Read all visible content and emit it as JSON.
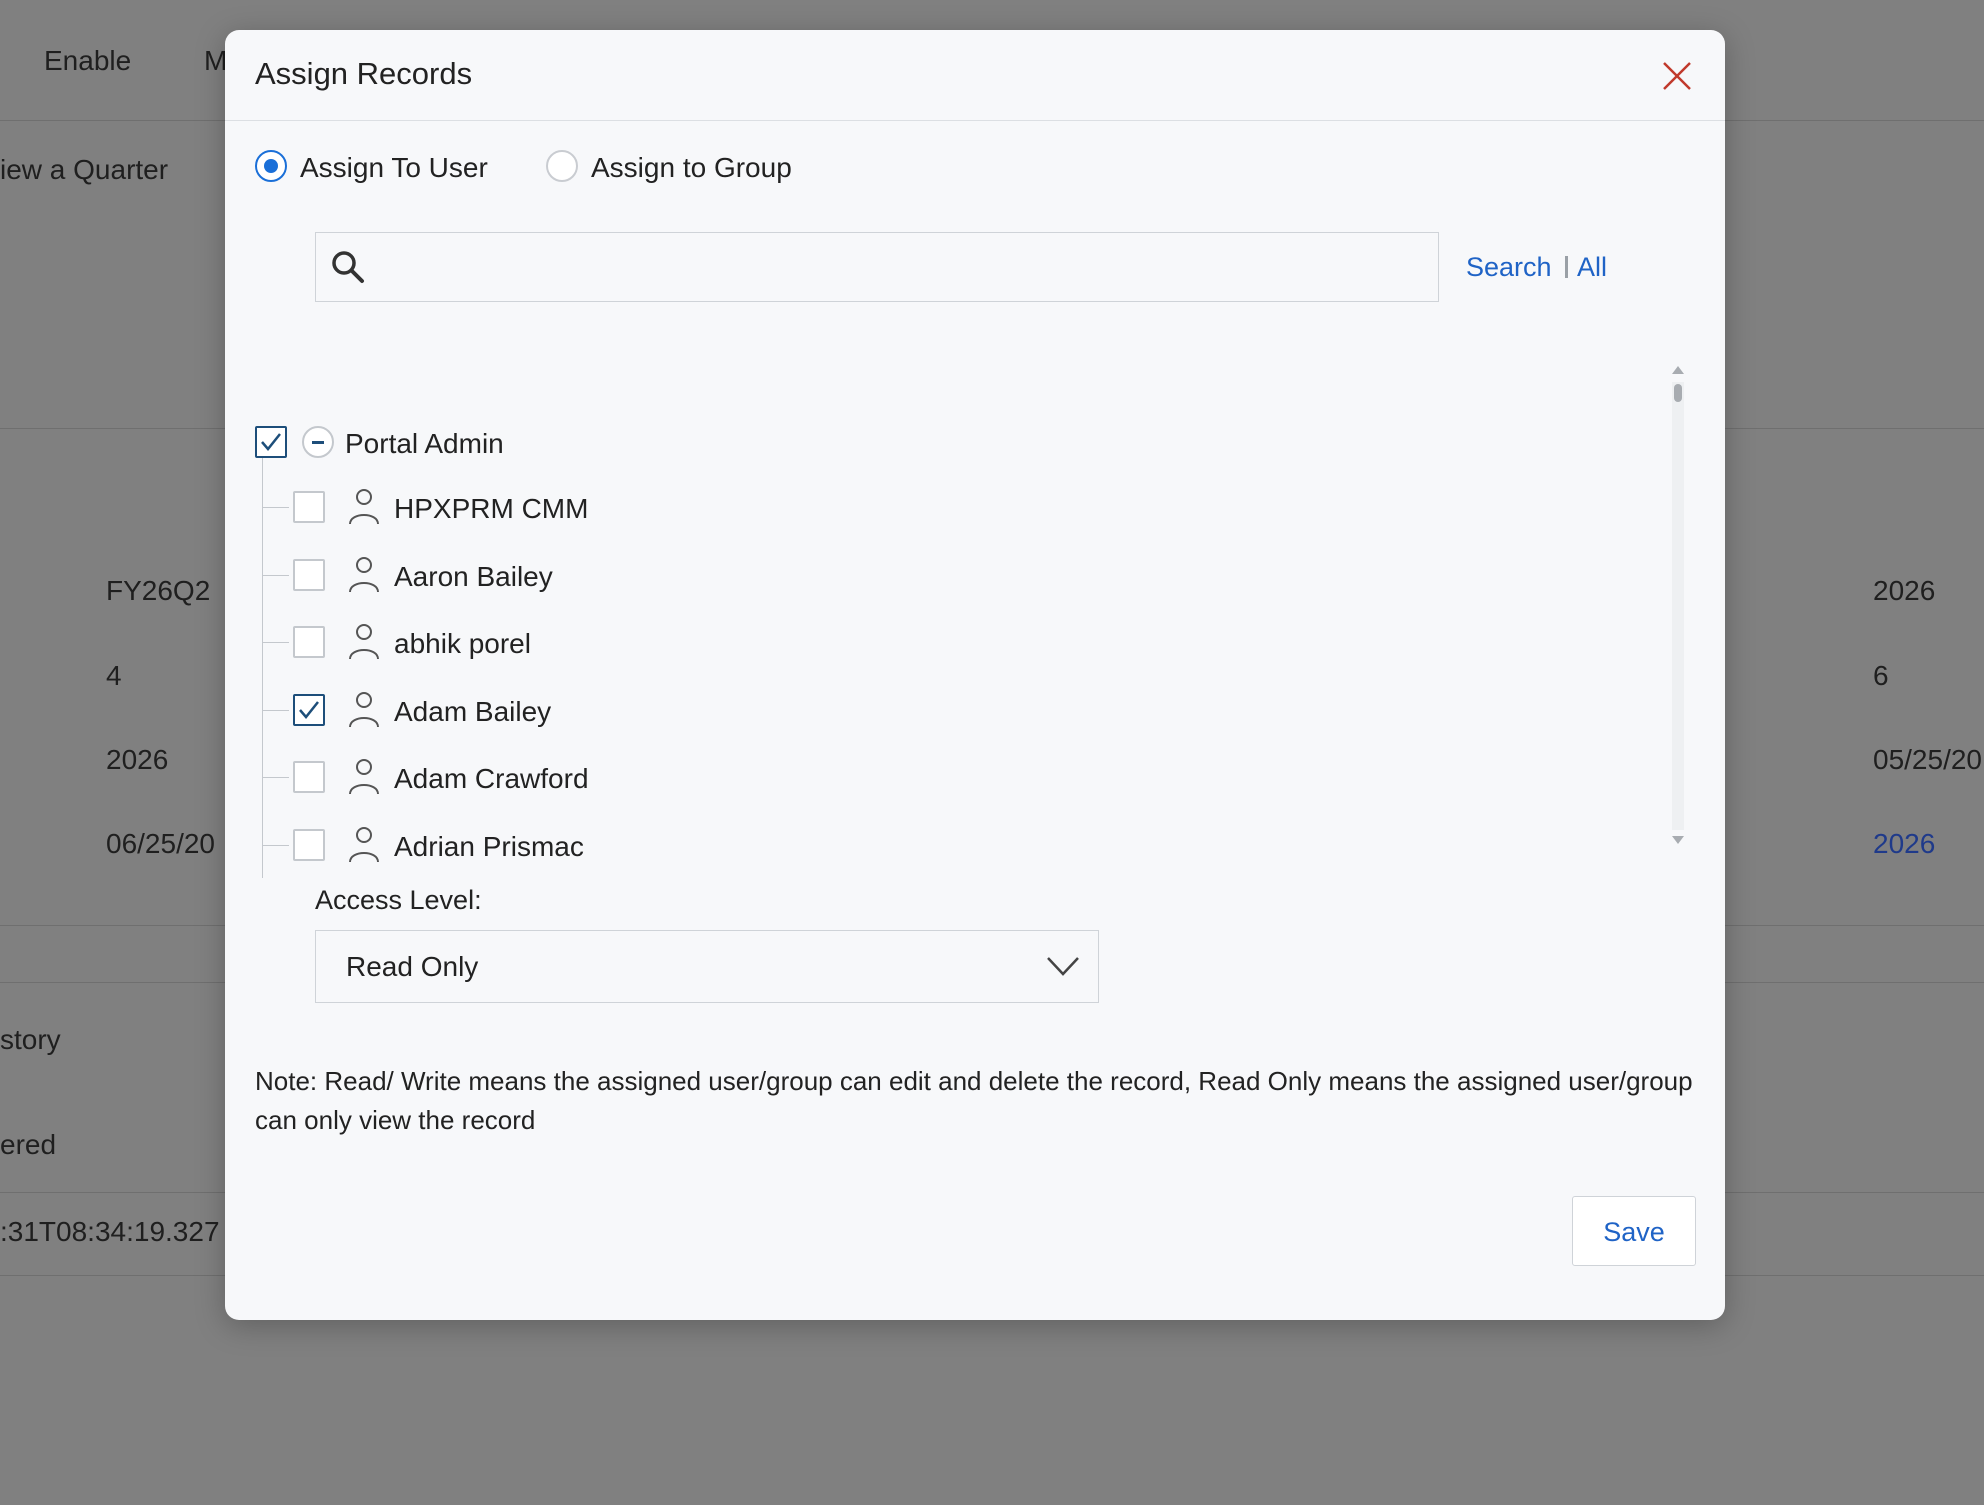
{
  "background": {
    "toolbar": [
      "Enable",
      "M"
    ],
    "subtitle": "iew a Quarter",
    "left_values": [
      "FY26Q2",
      "4",
      "2026",
      "06/25/20"
    ],
    "right_values": [
      "2026",
      "6",
      "05/25/20",
      "2026"
    ],
    "section_labels": [
      "story",
      "ered"
    ],
    "timestamp": ":31T08:34:19.327"
  },
  "modal": {
    "title": "Assign Records",
    "close_icon": "close-icon",
    "assign_options": [
      {
        "label": "Assign To User",
        "selected": true
      },
      {
        "label": "Assign to Group",
        "selected": false
      }
    ],
    "search": {
      "placeholder": "",
      "value": "",
      "search_link": "Search",
      "all_link": "All"
    },
    "tree": {
      "group": {
        "label": "Portal Admin",
        "checked": true,
        "expanded": true
      },
      "users": [
        {
          "name": "HPXPRM CMM",
          "checked": false
        },
        {
          "name": "Aaron Bailey",
          "checked": false
        },
        {
          "name": "abhik porel",
          "checked": false
        },
        {
          "name": "Adam Bailey",
          "checked": true
        },
        {
          "name": "Adam Crawford",
          "checked": false
        },
        {
          "name": "Adrian Prismac",
          "checked": false
        }
      ]
    },
    "access_level": {
      "label": "Access Level:",
      "selected": "Read Only"
    },
    "note": "Note: Read/ Write means the assigned user/group can edit and delete the record, Read Only means the assigned user/group can only view the record",
    "save_label": "Save"
  },
  "colors": {
    "accent": "#1a6fd8",
    "link": "#1f63c6",
    "check": "#1d4e7a",
    "close": "#c0392b",
    "overlay": "#808080"
  }
}
